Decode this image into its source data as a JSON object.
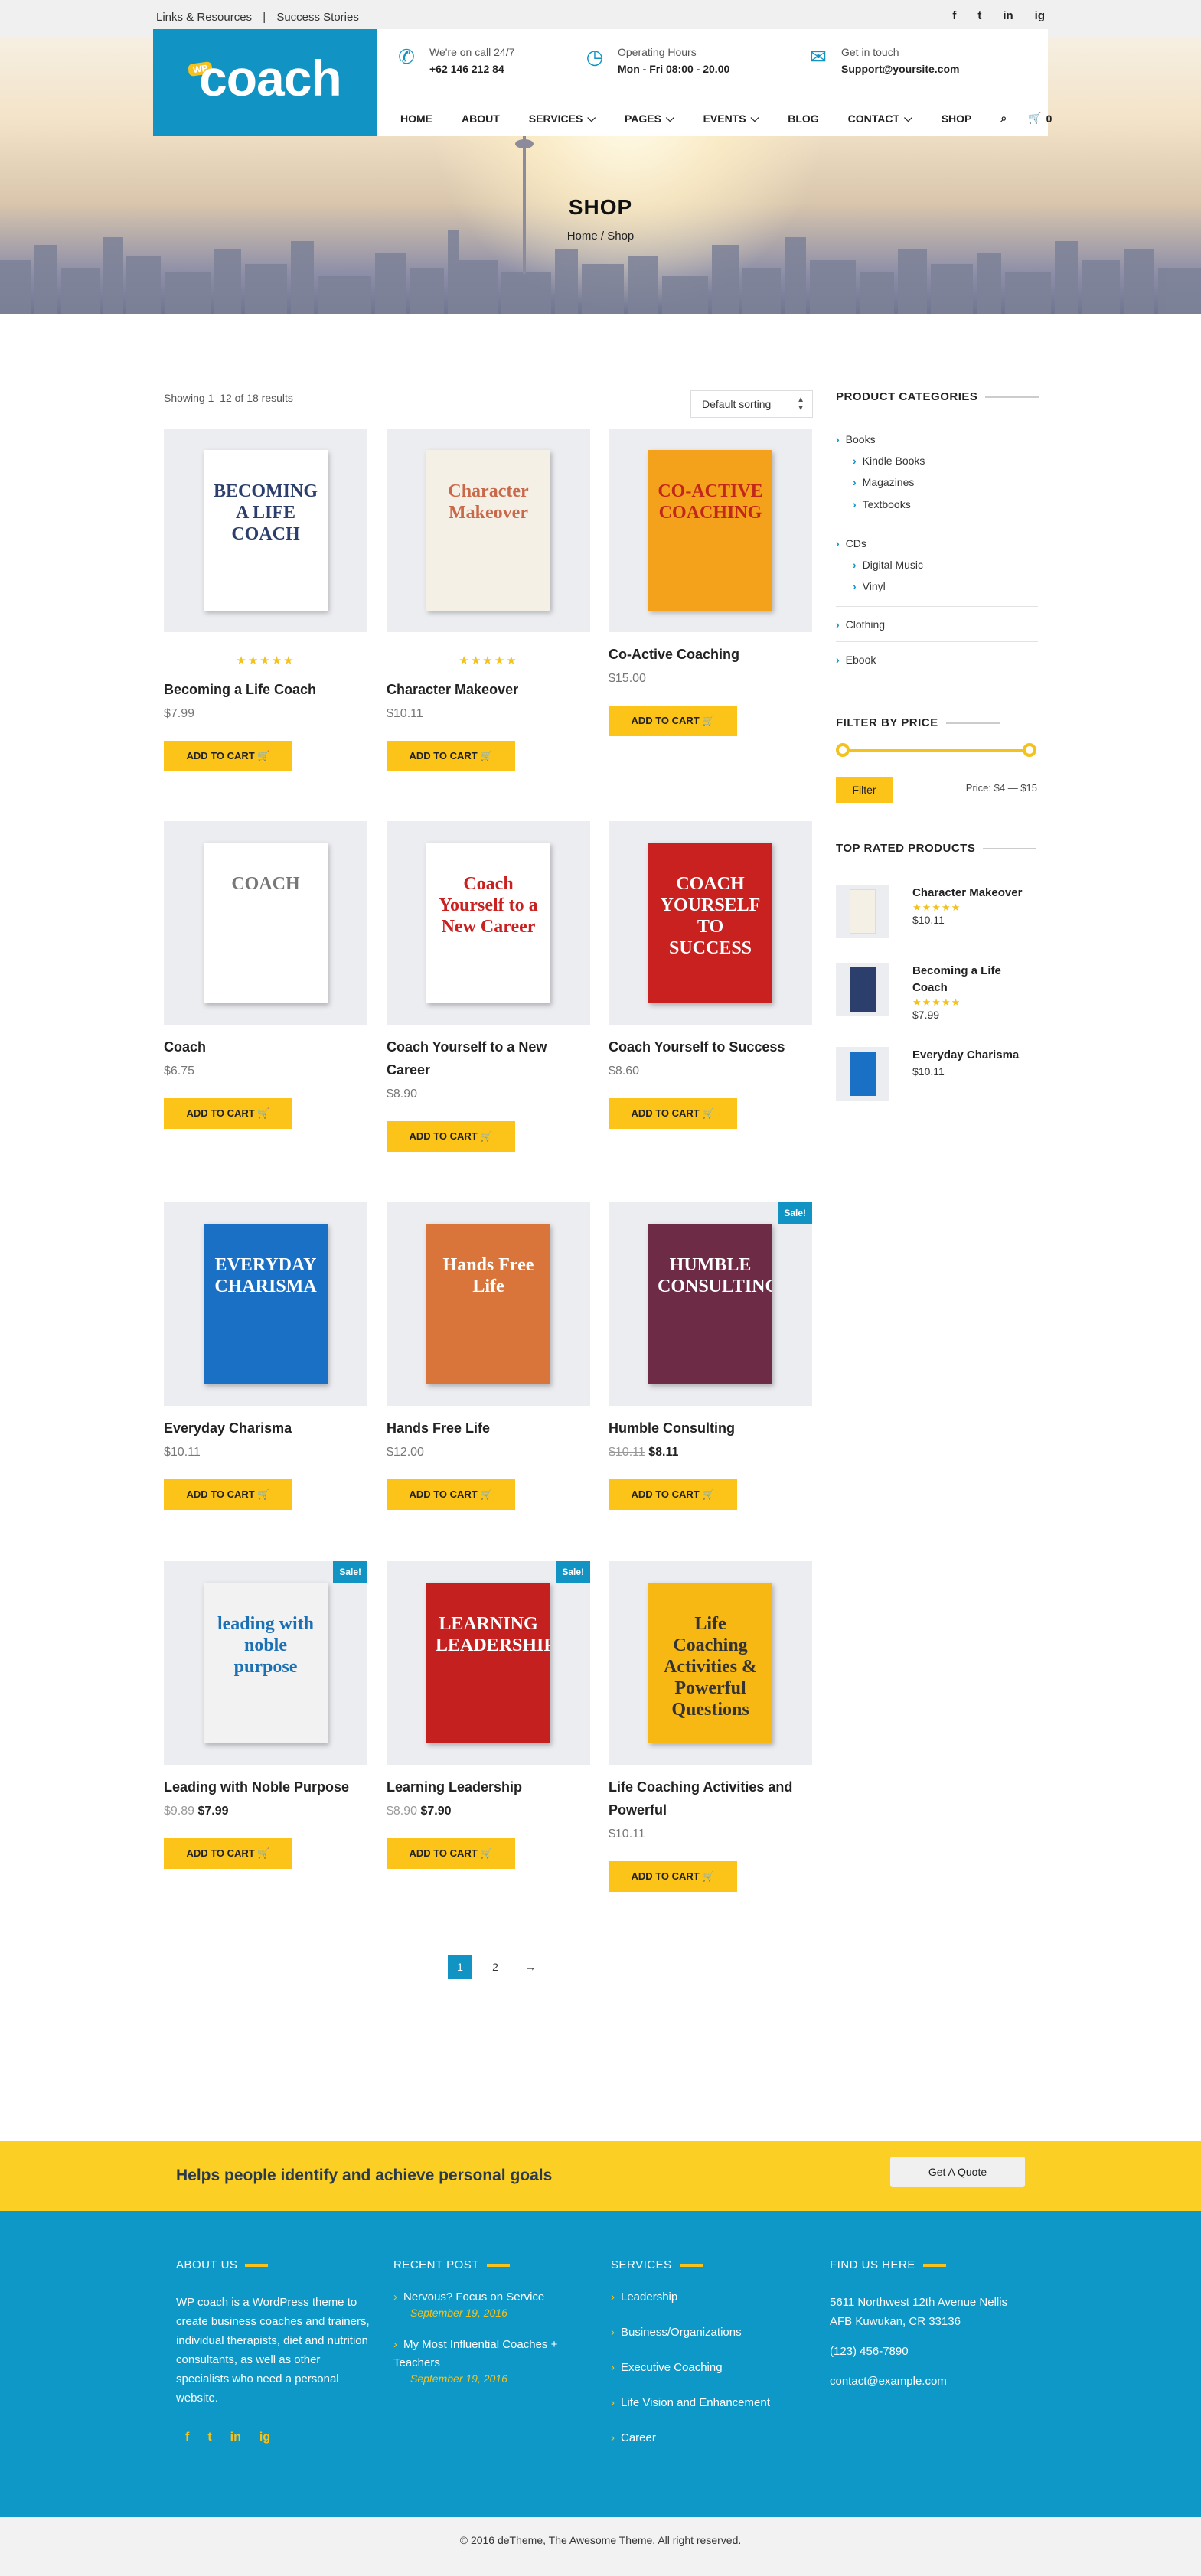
{
  "topbar": {
    "links": [
      "Links & Resources",
      "|",
      "Success Stories"
    ],
    "social": [
      "f",
      "t",
      "in",
      "ig"
    ]
  },
  "header": {
    "logo_badge": "WP",
    "logo_text": "coach",
    "info": [
      {
        "icon": "phone-icon",
        "glyph": "✆",
        "line1": "We're on call 24/7",
        "line2": "+62 146 212 84"
      },
      {
        "icon": "clock-icon",
        "glyph": "◷",
        "line1": "Operating Hours",
        "line2": "Mon - Fri 08:00 - 20.00"
      },
      {
        "icon": "envelope-icon",
        "glyph": "✉",
        "line1": "Get in touch",
        "line2": "Support@yoursite.com"
      }
    ],
    "nav": [
      "HOME",
      "ABOUT",
      "SERVICES",
      "PAGES",
      "EVENTS",
      "BLOG",
      "CONTACT",
      "SHOP"
    ],
    "cart_count": "0"
  },
  "hero": {
    "title": "SHOP",
    "breadcrumb": "Home / Shop"
  },
  "shop": {
    "showing": "Showing 1–12 of 18 results",
    "sorting": "Default sorting",
    "add_to_cart": "ADD TO CART",
    "products": [
      {
        "title": "Becoming a Life Coach",
        "price": "$7.99",
        "rating": "★★★★★",
        "book_bg": "#fff",
        "book_text": "BECOMING A LIFE COACH",
        "book_color": "#2c3e6b"
      },
      {
        "title": "Character Makeover",
        "price": "$10.11",
        "rating": "★★★★★",
        "book_bg": "#f5f0e6",
        "book_text": "Character Makeover",
        "book_color": "#c9694a"
      },
      {
        "title": "Co-Active Coaching",
        "price": "$15.00",
        "book_bg": "#f4a21b",
        "book_text": "CO-ACTIVE COACHING",
        "book_color": "#c2271b"
      },
      {
        "title": "Coach",
        "price": "$6.75",
        "book_bg": "#fff",
        "book_text": "COACH",
        "book_color": "#777"
      },
      {
        "title": "Coach Yourself to a New Career",
        "price": "$8.90",
        "book_bg": "#fff",
        "book_text": "Coach Yourself to a New Career",
        "book_color": "#c8211f"
      },
      {
        "title": "Coach Yourself to Success",
        "price": "$8.60",
        "book_bg": "#c8211f",
        "book_text": "COACH YOURSELF TO SUCCESS",
        "book_color": "#fff"
      },
      {
        "title": "Everyday Charisma",
        "price": "$10.11",
        "book_bg": "#1a70c5",
        "book_text": "EVERYDAY CHARISMA",
        "book_color": "#fff"
      },
      {
        "title": "Hands Free Life",
        "price": "$12.00",
        "book_bg": "#d9753b",
        "book_text": "Hands Free Life",
        "book_color": "#fff"
      },
      {
        "title": "Humble Consulting",
        "old_price": "$10.11",
        "price": "$8.11",
        "sale": "Sale!",
        "book_bg": "#6e2b45",
        "book_text": "HUMBLE CONSULTING",
        "book_color": "#fff"
      },
      {
        "title": "Leading with Noble Purpose",
        "old_price": "$9.89",
        "price": "$7.99",
        "sale": "Sale!",
        "book_bg": "#f2f2f2",
        "book_text": "leading with noble purpose",
        "book_color": "#1a6fb5"
      },
      {
        "title": "Learning Leadership",
        "old_price": "$8.90",
        "price": "$7.90",
        "sale": "Sale!",
        "book_bg": "#c3201f",
        "book_text": "LEARNING LEADERSHIP",
        "book_color": "#fff"
      },
      {
        "title": "Life Coaching Activities and Powerful",
        "price": "$10.11",
        "book_bg": "#f7b813",
        "book_text": "Life Coaching Activities & Powerful Questions",
        "book_color": "#333"
      }
    ],
    "pages": [
      "1",
      "2",
      "→"
    ]
  },
  "sidebar": {
    "categories_title": "PRODUCT CATEGORIES",
    "categories": [
      {
        "label": "Books",
        "level": 0
      },
      {
        "label": "Kindle Books",
        "level": 1
      },
      {
        "label": "Magazines",
        "level": 1
      },
      {
        "label": "Textbooks",
        "level": 1
      },
      {
        "label": "CDs",
        "level": 0
      },
      {
        "label": "Digital Music",
        "level": 1
      },
      {
        "label": "Vinyl",
        "level": 1
      },
      {
        "label": "Clothing",
        "level": 0
      },
      {
        "label": "Ebook",
        "level": 0
      }
    ],
    "filter_title": "FILTER BY PRICE",
    "filter_button": "Filter",
    "price_range": "Price: $4 — $15",
    "top_title": "TOP RATED PRODUCTS",
    "top": [
      {
        "title": "Character Makeover",
        "rating": "★★★★★",
        "price": "$10.11"
      },
      {
        "title": "Becoming a Life Coach",
        "rating": "★★★★★",
        "price": "$7.99"
      },
      {
        "title": "Everyday Charisma",
        "price": "$10.11"
      }
    ]
  },
  "cta": {
    "text": "Helps people identify and achieve personal goals",
    "button": "Get A Quote"
  },
  "footer": {
    "about_title": "ABOUT US",
    "about_text": "WP coach is a WordPress theme to create business coaches and trainers, individual therapists, diet and nutrition consultants, as well as other specialists who need a personal website.",
    "social": [
      "f",
      "t",
      "in",
      "ig"
    ],
    "recent_title": "RECENT POST",
    "posts": [
      {
        "title": "Nervous? Focus on Service",
        "date": "September 19, 2016"
      },
      {
        "title": "My Most Influential Coaches + Teachers",
        "date": "September 19, 2016"
      }
    ],
    "services_title": "SERVICES",
    "services": [
      "Leadership",
      "Business/Organizations",
      "Executive Coaching",
      "Life Vision and Enhancement",
      "Career"
    ],
    "find_title": "FIND US HERE",
    "address": "5611 Northwest 12th Avenue Nellis AFB Kuwukan, CR 33136",
    "phone": "(123) 456-7890",
    "email": "contact@example.com",
    "copyright": "© 2016 deTheme, The Awesome Theme. All right reserved."
  }
}
